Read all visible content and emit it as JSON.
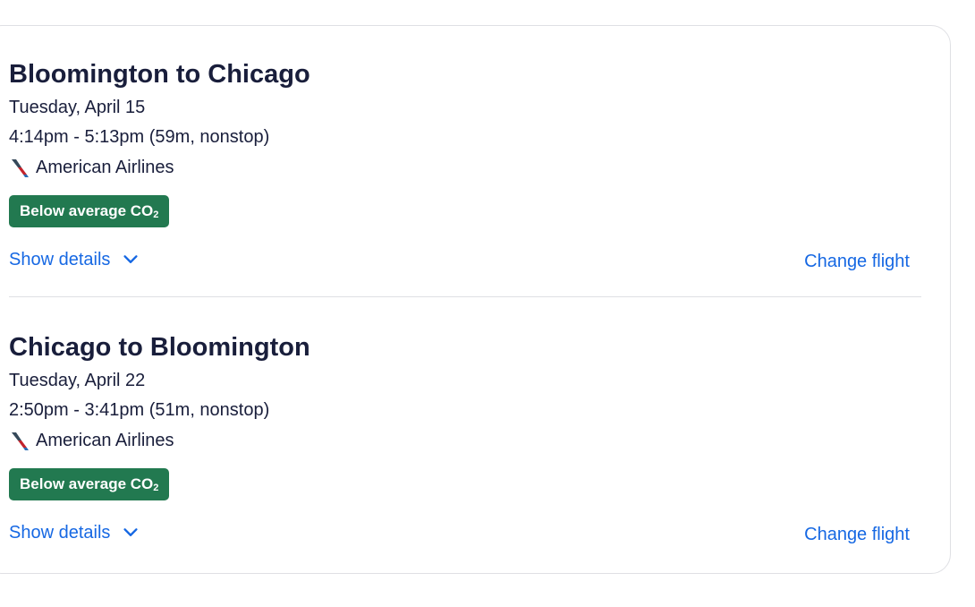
{
  "flights": [
    {
      "title": "Bloomington to Chicago",
      "date": "Tuesday, April 15",
      "times": "4:14pm - 5:13pm (59m, nonstop)",
      "airline": "American Airlines",
      "badge": "Below average CO",
      "badge_sub": "2",
      "show_details": "Show details",
      "change_flight": "Change flight"
    },
    {
      "title": "Chicago to Bloomington",
      "date": "Tuesday, April 22",
      "times": "2:50pm - 3:41pm (51m, nonstop)",
      "airline": "American Airlines",
      "badge": "Below average CO",
      "badge_sub": "2",
      "show_details": "Show details",
      "change_flight": "Change flight"
    }
  ],
  "colors": {
    "link": "#1668e3",
    "badge_bg": "#227950",
    "text": "#191e3b",
    "border": "#dfe0e4"
  },
  "icons": {
    "airline": "american-airlines-logo-icon",
    "expand": "chevron-down-icon"
  }
}
